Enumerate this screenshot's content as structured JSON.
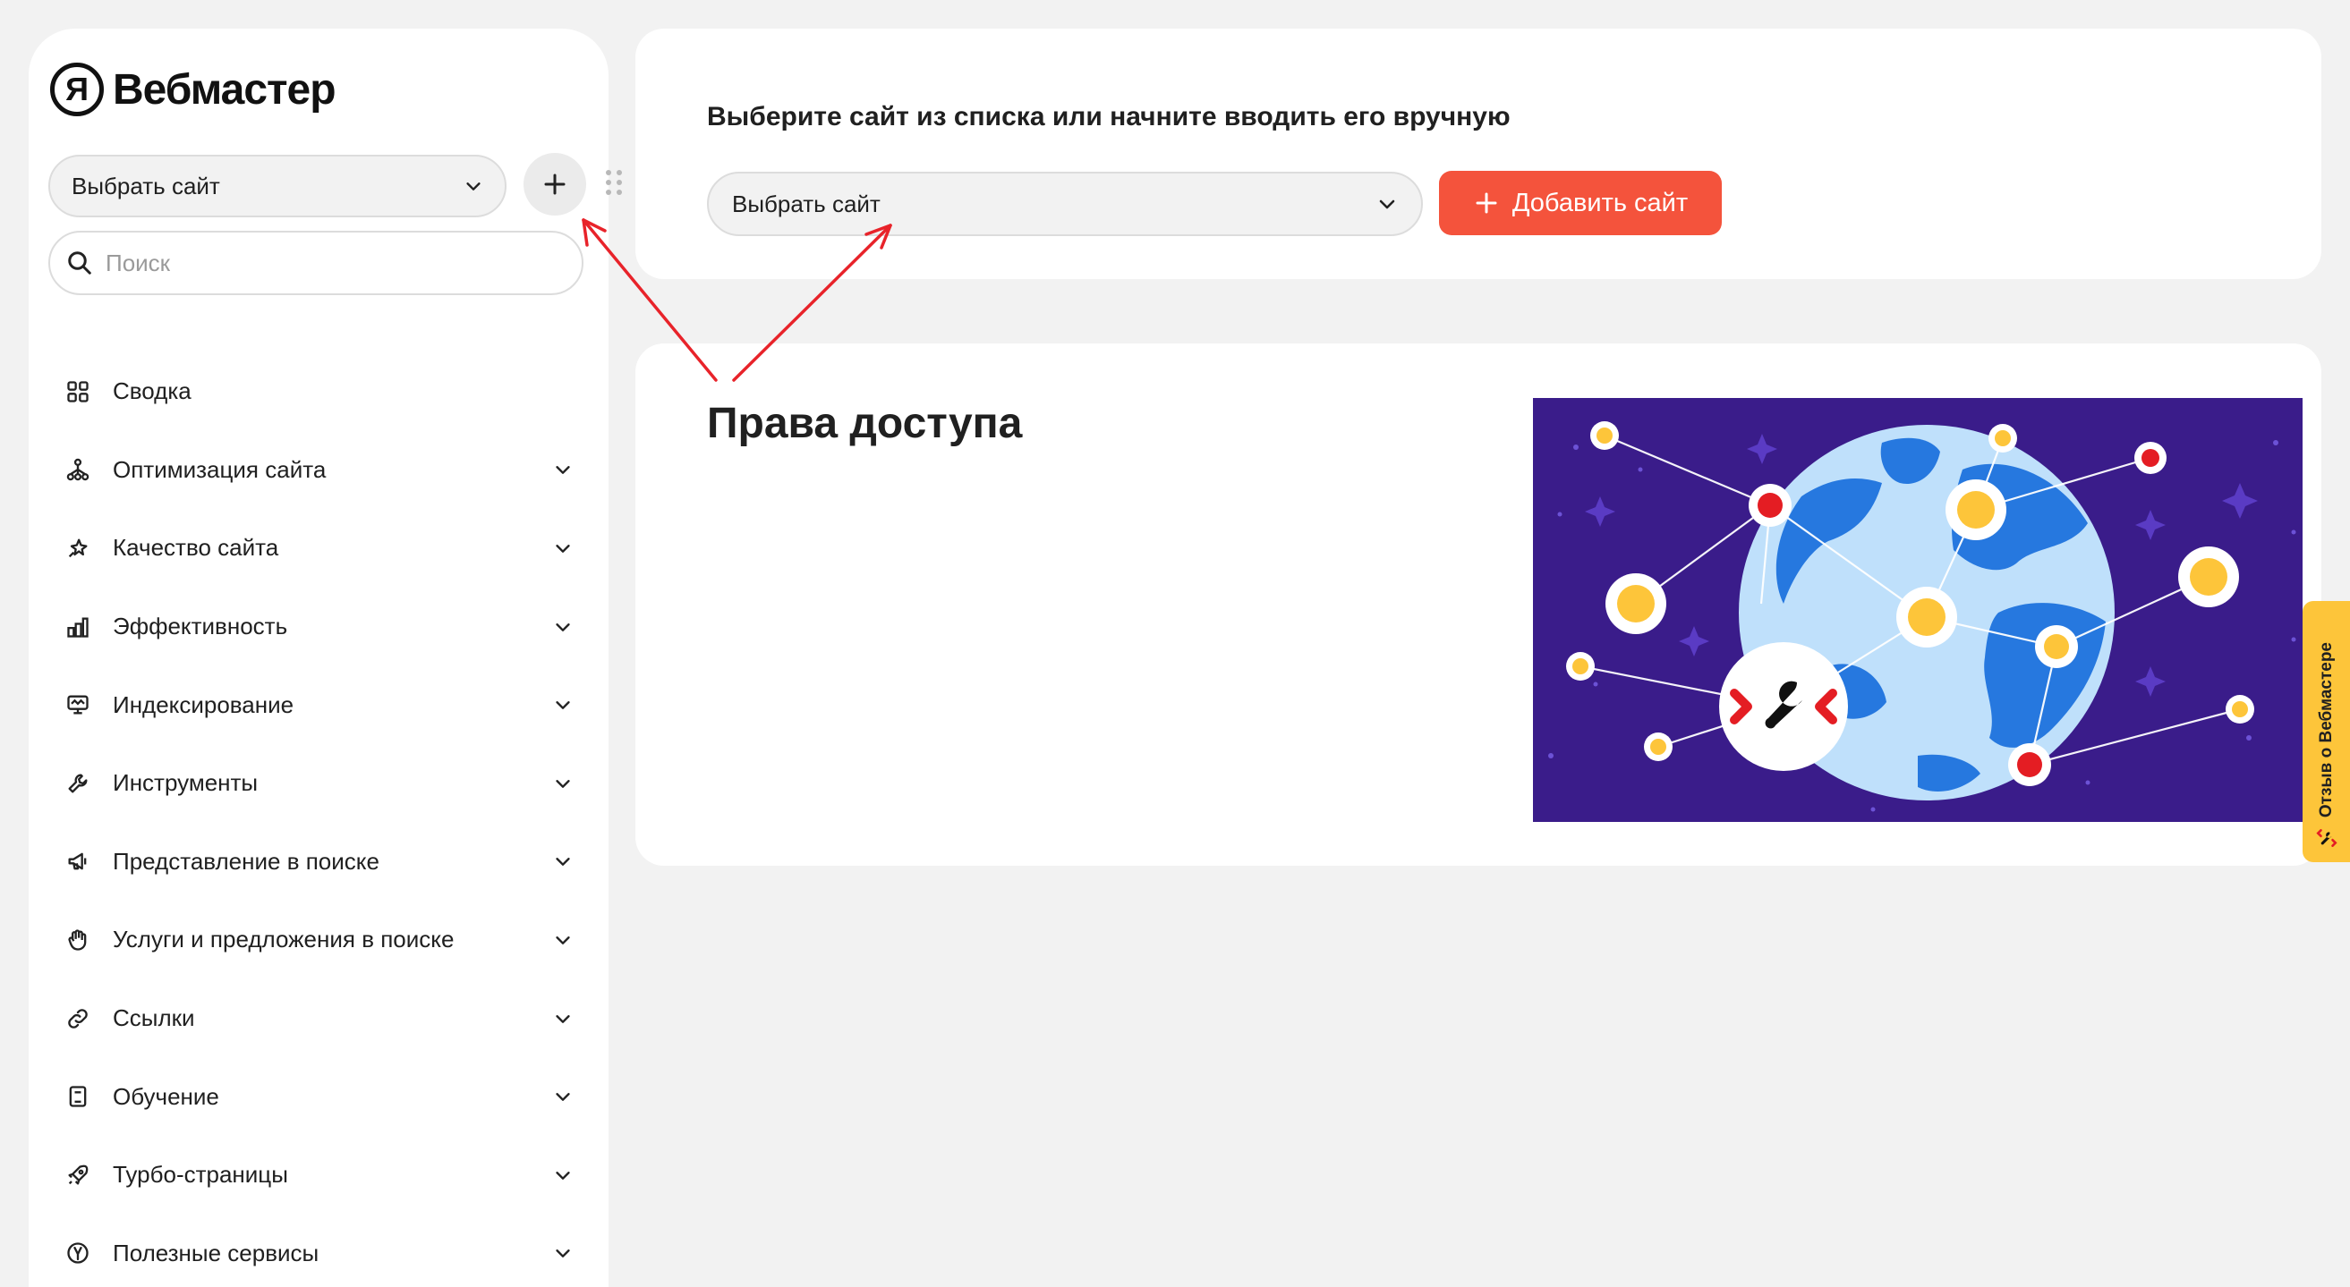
{
  "logo": {
    "mark": "Я",
    "text": "Вебмастер"
  },
  "sidebar": {
    "site_select": "Выбрать сайт",
    "search_placeholder": "Поиск",
    "items": [
      {
        "label": "Сводка",
        "icon": "grid-icon",
        "expandable": false
      },
      {
        "label": "Оптимизация сайта",
        "icon": "sitemap-icon",
        "expandable": true
      },
      {
        "label": "Качество сайта",
        "icon": "sparkle-star-icon",
        "expandable": true
      },
      {
        "label": "Эффективность",
        "icon": "bar-chart-icon",
        "expandable": true
      },
      {
        "label": "Индексирование",
        "icon": "monitor-icon",
        "expandable": true
      },
      {
        "label": "Инструменты",
        "icon": "wrench-icon",
        "expandable": true
      },
      {
        "label": "Представление в поиске",
        "icon": "megaphone-icon",
        "expandable": true
      },
      {
        "label": "Услуги и предложения в поиске",
        "icon": "hand-icon",
        "expandable": true
      },
      {
        "label": "Ссылки",
        "icon": "link-icon",
        "expandable": true
      },
      {
        "label": "Обучение",
        "icon": "book-icon",
        "expandable": true
      },
      {
        "label": "Турбо-страницы",
        "icon": "rocket-icon",
        "expandable": true
      },
      {
        "label": "Полезные сервисы",
        "icon": "yandex-circle-icon",
        "expandable": true
      }
    ]
  },
  "site_picker": {
    "title": "Выберите сайт из списка или начните вводить его вручную",
    "select_value": "Выбрать сайт",
    "add_button": "Добавить сайт"
  },
  "main": {
    "title": "Права доступа",
    "illustration": "globe-network-wrench-illustration"
  },
  "feedback": {
    "label": "Отзыв о Вебмастере"
  },
  "colors": {
    "accent": "#f4533c",
    "feedback_bg": "#fdc53a",
    "illustration_bg": "#3a1c8a",
    "annotation_arrow": "#e8232a"
  }
}
